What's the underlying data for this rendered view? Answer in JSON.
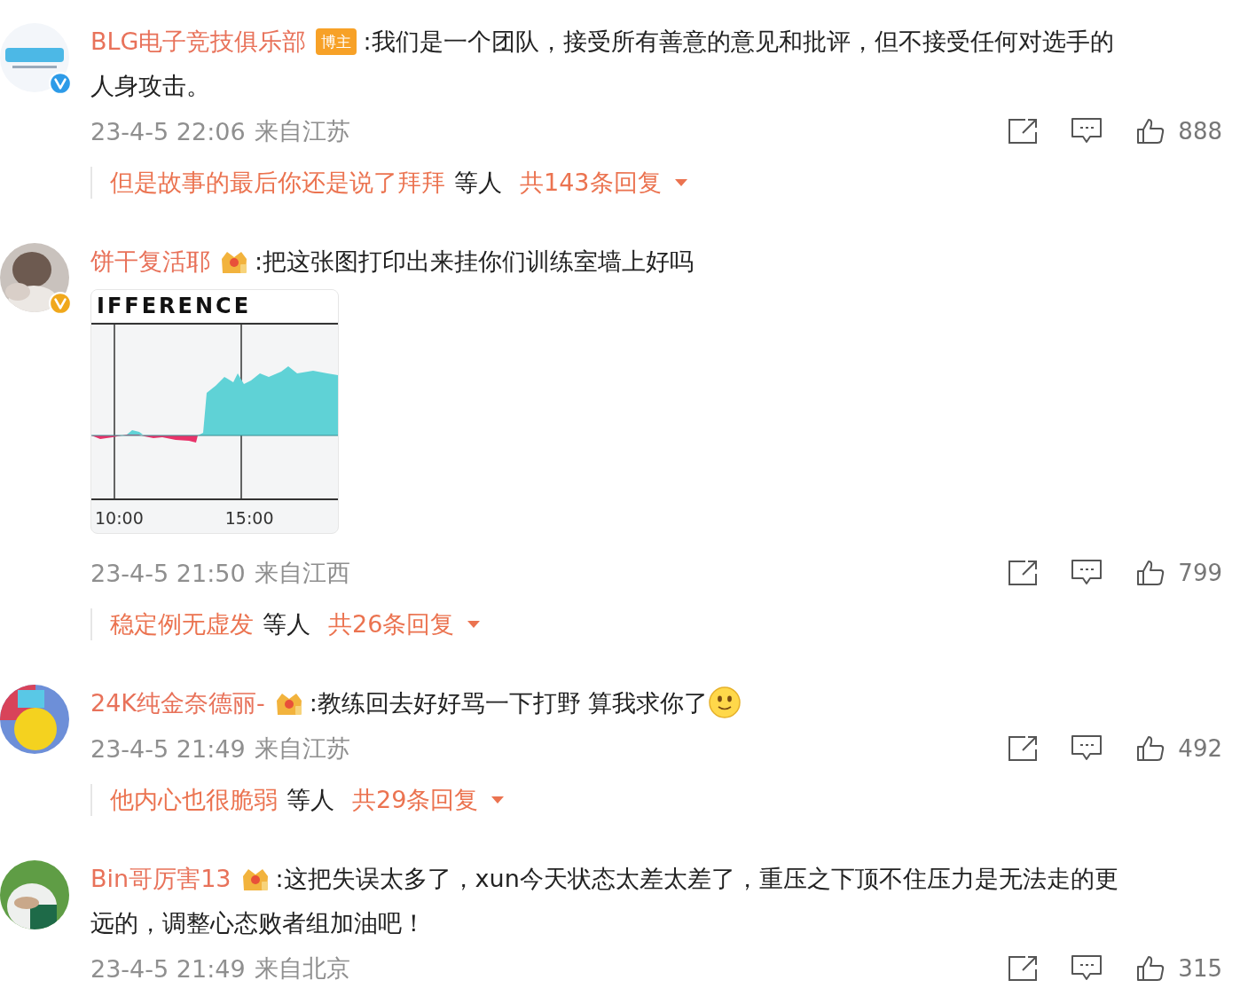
{
  "comments": [
    {
      "author": "BLG电子竞技俱乐部",
      "verified": {
        "color": "#2d9be8"
      },
      "badge": {
        "kind": "tag",
        "label": "博主"
      },
      "text": [
        ":我们是一个团队，接受所有善意的意见和批评，但不接受任何对选手的",
        "人身攻击。"
      ],
      "time": "23-4-5 22:06",
      "location": "来自江苏",
      "likes": "888",
      "replies": {
        "first": "但是故事的最后你还是说了拜拜",
        "suffix": "等人",
        "total": "共143条回复"
      }
    },
    {
      "author": "饼干复活耶",
      "verified": {
        "color": "#f0a81c"
      },
      "badge": {
        "kind": "crown"
      },
      "text": [
        ":把这张图打印出来挂你们训练室墙上好吗"
      ],
      "image": {
        "title": "IFFERENCE",
        "x_labels": [
          "10:00",
          "15:00"
        ]
      },
      "time": "23-4-5 21:50",
      "location": "来自江西",
      "likes": "799",
      "replies": {
        "first": "稳定例无虚发",
        "suffix": "等人",
        "total": "共26条回复"
      }
    },
    {
      "author": "24K纯金奈德丽-",
      "badge": {
        "kind": "crown"
      },
      "text": [
        ":教练回去好好骂一下打野 算我求你了"
      ],
      "emoji": true,
      "time": "23-4-5 21:49",
      "location": "来自江苏",
      "likes": "492",
      "replies": {
        "first": "他内心也很脆弱",
        "suffix": "等人",
        "total": "共29条回复"
      }
    },
    {
      "author": "Bin哥厉害13",
      "badge": {
        "kind": "crown"
      },
      "text": [
        ":这把失误太多了，xun今天状态太差太差了，重压之下顶不住压力是无法走的更",
        "远的，调整心态败者组加油吧！"
      ],
      "time": "23-4-5 21:49",
      "location": "来自北京",
      "likes": "315"
    }
  ]
}
